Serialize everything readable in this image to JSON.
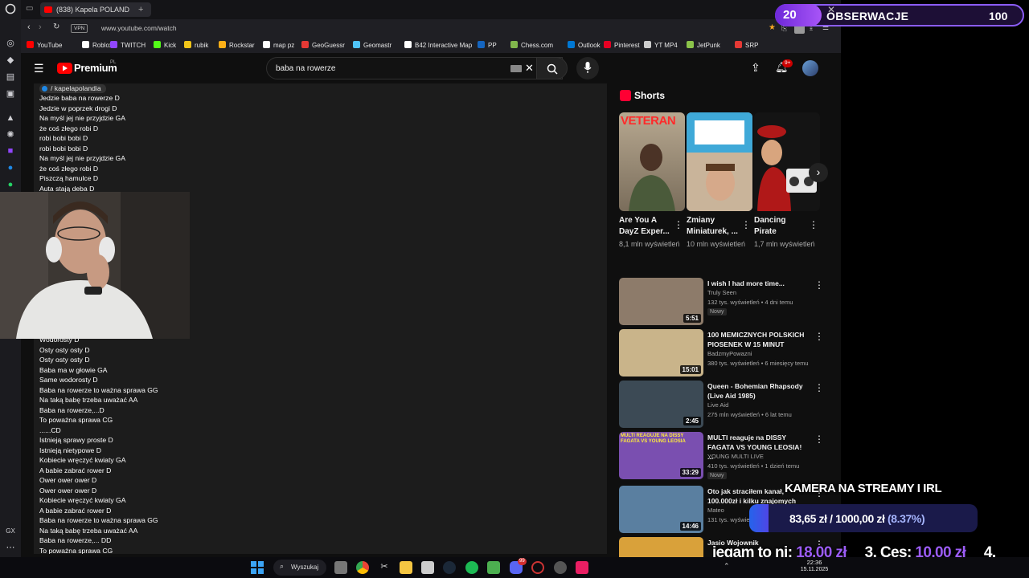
{
  "browser": {
    "tabs": [
      {
        "label": "(838) Kapela POLAND"
      }
    ],
    "address": {
      "vpn_badge": "VPN",
      "url": "www.youtube.com/watch"
    },
    "bookmarks": [
      {
        "label": "YouTube",
        "color": "#ff0000"
      },
      {
        "label": "Roblox",
        "color": "#ffffff"
      },
      {
        "label": "TWITCH",
        "color": "#9146ff"
      },
      {
        "label": "Kick",
        "color": "#53fc18"
      },
      {
        "label": "rubik",
        "color": "#f0c419"
      },
      {
        "label": "Rockstar",
        "color": "#fcaf17"
      },
      {
        "label": "map pz",
        "color": "#ffffff"
      },
      {
        "label": "GeoGuessr",
        "color": "#e53935"
      },
      {
        "label": "Geomastr",
        "color": "#4fc3f7"
      },
      {
        "label": "B42 Interactive Map",
        "color": "#ffffff"
      },
      {
        "label": "PP",
        "color": "#1565c0"
      },
      {
        "label": "Chess.com",
        "color": "#81b64c"
      },
      {
        "label": "Outlook",
        "color": "#0078d4"
      },
      {
        "label": "Pinterest",
        "color": "#e60023"
      },
      {
        "label": "YT MP4",
        "color": "#cccccc"
      },
      {
        "label": "JetPunk",
        "color": "#8bc34a"
      },
      {
        "label": "SRP",
        "color": "#e53935"
      }
    ]
  },
  "youtube": {
    "logo": "Premium",
    "region": "PL",
    "search_value": "baba na rowerze",
    "notification_badge": "9+",
    "account_tag": "/ kapelapolandia",
    "lyrics_top": [
      "Jedzie baba na rowerze D",
      "Jedzie w poprzek drogi D",
      "Na myśl jej nie przyjdzie GA",
      "że coś złego robi D",
      "robi bobi bobi D",
      "robi bobi bobi D",
      "Na myśl jej nie przyjdzie GA",
      "że coś złego robi D",
      "Piszczą hamulce D",
      "Auta stają deba D"
    ],
    "lyrics_bottom": [
      "Wodorosty D",
      "Osty osty osty D",
      "Osty osty osty D",
      "Baba ma w głowie GA",
      "Same wodorosty D",
      "Baba na rowerze to ważna sprawa GG",
      "Na taką babę trzeba uważać AA",
      "Baba na rowerze,...D",
      "To poważna sprawa CG",
      "......CD",
      "Istnieją sprawy proste D",
      "Istnieją nietypowe D",
      "Kobiecie wręczyć kwiaty GA",
      "A babie zabrać rower D",
      "Ower ower ower D",
      "Ower ower ower D",
      "Kobiecie wręczyć kwiaty GA",
      "A babie zabrać rower D",
      "Baba na rowerze to ważna sprawa GG",
      "Na taką babę trzeba uważać AA",
      "Baba na rowerze,... DD",
      "To poważna sprawa CG"
    ],
    "shorts_title": "Shorts",
    "shorts": [
      {
        "title": "Are You A DayZ Exper...",
        "views": "8,1 mln wyświetleń",
        "thumb_text": "VETERAN"
      },
      {
        "title": "Zmiany Miniaturek, ...",
        "views": "10 mln wyświetleń"
      },
      {
        "title": "Dancing Pirate",
        "views": "1,7 mln wyświetleń"
      }
    ],
    "videos": [
      {
        "title": "I wish I had more time...",
        "channel": "Truly Seen",
        "meta": "132 tys. wyświetleń • 4 dni temu",
        "badge": "Nowy",
        "duration": "5:51",
        "bg": "#8d7b6a"
      },
      {
        "title": "100 MEMICZNYCH POLSKICH PIOSENEK W 15 MINUT",
        "channel": "BadzmyPowazni",
        "meta": "380 tys. wyświetleń • 6 miesięcy temu",
        "duration": "15:01",
        "bg": "#c9b48a"
      },
      {
        "title": "Queen - Bohemian Rhapsody (Live Aid 1985)",
        "channel": "Live Aid",
        "meta": "275 mln wyświetleń • 6 lat temu",
        "duration": "2:45",
        "bg": "#3c4a55"
      },
      {
        "title": "MULTI reaguje na DISSY FAGATA VS YOUNG LEOSIA! ...",
        "channel": "YOUNG MULTI LIVE",
        "meta": "410 tys. wyświetleń • 1 dzień temu",
        "badge": "Nowy",
        "duration": "33:29",
        "bg": "#7a4fb0",
        "thumb_text": "MULTI REAGUJE NA DISSY FAGATA VS YOUNG LEOSIA"
      },
      {
        "title": "Oto jak straciłem kanał, 100.000zł i kilku znajomych",
        "channel": "Mateo",
        "meta": "131 tys. wyświetleń",
        "duration": "14:46",
        "bg": "#5a7fa0"
      },
      {
        "title": "Jasio Wojownik",
        "channel": "",
        "meta": "",
        "duration": "",
        "bg": "#d9a13a"
      }
    ]
  },
  "overlay": {
    "level": "20",
    "follow_label": "OBSERWACJE",
    "follow_count": "100",
    "camera_goal_title": "KAMERA NA STREAMY I IRL",
    "goal_current": "83,65 zł",
    "goal_separator": "/",
    "goal_target": "1000,00 zł",
    "goal_percent": "(8.37%)",
    "goal_progress": 0.0837,
    "ticker": [
      {
        "label": "iegam to ni:",
        "value": "18,00 zł"
      },
      {
        "label": "3. Ces:",
        "value": "10,00 zł"
      },
      {
        "label": "4.",
        "value": ""
      }
    ]
  },
  "taskbar": {
    "search_label": "Wyszukaj",
    "time": "22:36",
    "date": "15.11.2025",
    "discord_badge": "99"
  }
}
